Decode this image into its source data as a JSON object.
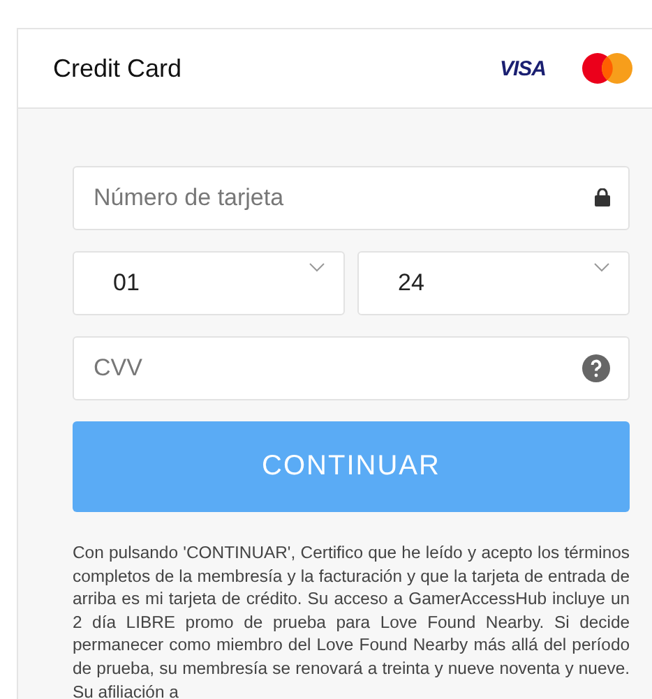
{
  "header": {
    "title": "Credit Card",
    "brands": [
      "VISA"
    ]
  },
  "form": {
    "card_number": {
      "placeholder": "Número de tarjeta"
    },
    "month": {
      "value": "01"
    },
    "year": {
      "value": "24"
    },
    "cvv": {
      "placeholder": "CVV"
    },
    "submit": "CONTINUAR"
  },
  "terms": "Con pulsando 'CONTINUAR', Certifico que he leído y acepto los términos completos de la membresía y la facturación y que la tarjeta de entrada de arriba es mi tarjeta de crédito. Su acceso a GamerAccessHub incluye un 2 día LIBRE promo de prueba para Love Found Nearby. Si decide permanecer como miembro del Love Found Nearby más allá del período de prueba, su membresía se renovará a treinta y nueve noventa y nueve. Su afiliación a"
}
